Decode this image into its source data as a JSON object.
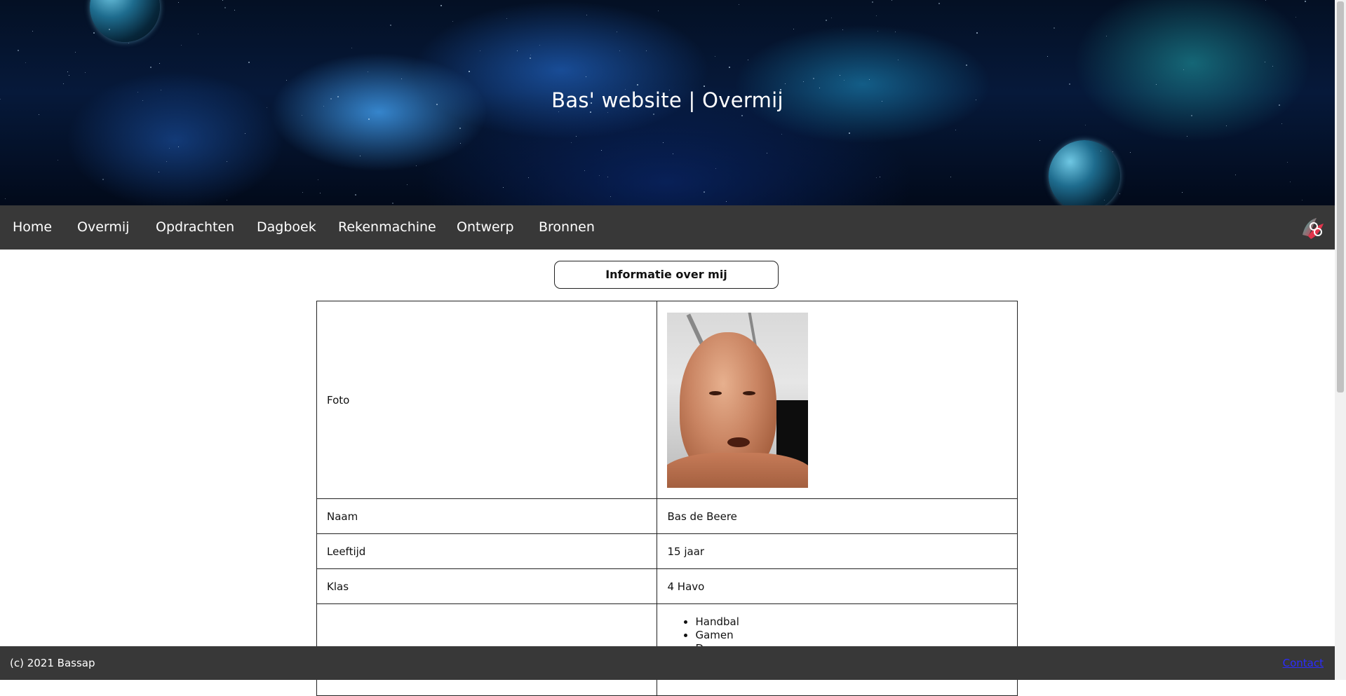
{
  "header": {
    "title": "Bas' website | Overmij"
  },
  "nav": {
    "items": [
      {
        "label": "Home"
      },
      {
        "label": "Overmij"
      },
      {
        "label": "Opdrachten"
      },
      {
        "label": "Dagboek"
      },
      {
        "label": "Rekenmachine"
      },
      {
        "label": "Ontwerp"
      },
      {
        "label": "Bronnen"
      }
    ],
    "logo_icon": "bb-logo-icon"
  },
  "main": {
    "section_button": "Informatie over mij",
    "table": {
      "rows": [
        {
          "label": "Foto",
          "value": ""
        },
        {
          "label": "Naam",
          "value": "Bas de Beere"
        },
        {
          "label": "Leeftijd",
          "value": "15 jaar"
        },
        {
          "label": "Klas",
          "value": "4 Havo"
        },
        {
          "label": "",
          "value": ""
        }
      ],
      "hobbies": [
        "Handbal",
        "Gamen",
        "D..."
      ]
    }
  },
  "footer": {
    "copyright": "(c) 2021 Bassap",
    "contact_link": "Contact"
  },
  "colors": {
    "nav_bg": "#383838",
    "footer_bg": "#383838",
    "link": "#2b2bff"
  }
}
